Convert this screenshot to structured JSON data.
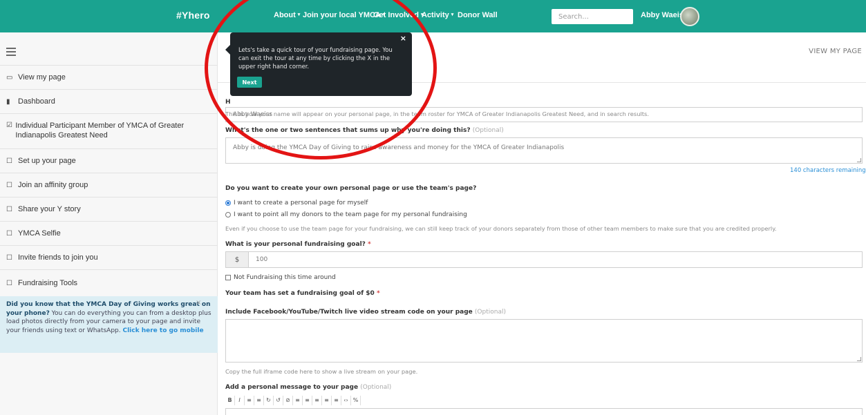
{
  "nav": {
    "brand": "#Yhero",
    "items": [
      {
        "label": "About",
        "caret": "▾"
      },
      {
        "label": "Join your local YMCA",
        "caret": "▾"
      },
      {
        "label": "Get Involved",
        "caret": "▾"
      },
      {
        "label": "Activity",
        "caret": "▾"
      },
      {
        "label": "Donor Wall",
        "caret": ""
      }
    ],
    "search_placeholder": "Search...",
    "username": "Abby Waeiss"
  },
  "sidebar": {
    "items": [
      {
        "icon": "▭",
        "label": "View my page"
      },
      {
        "icon": "▮",
        "label": "Dashboard"
      },
      {
        "icon": "☑",
        "label": "Individual Participant Member of YMCA of Greater Indianapolis Greatest Need"
      },
      {
        "icon": "☐",
        "label": "Set up your page"
      },
      {
        "icon": "☐",
        "label": "Join an affinity group"
      },
      {
        "icon": "☐",
        "label": "Share your Y story"
      },
      {
        "icon": "☐",
        "label": "YMCA Selfie"
      },
      {
        "icon": "☐",
        "label": "Invite friends to join you"
      },
      {
        "icon": "☐",
        "label": "Fundraising Tools"
      }
    ],
    "promo": {
      "bold": "Did you know that the YMCA Day of Giving works great on your phone?",
      "text": " You can do everything you can from a desktop plus load photos directly from your camera to your page and invite your friends using text or WhatsApp. ",
      "link": "Click here to go mobile",
      "close": "×"
    }
  },
  "main": {
    "view_my_page": "VIEW MY PAGE",
    "name_label_fragment": "H",
    "name_value": "Abby Waeiss",
    "name_help": "This is how your name will appear on your personal page, in the team roster for YMCA of Greater Indianapolis Greatest Need, and in search results.",
    "why_label": "What's the one or two sentences that sums up why you're doing this?",
    "optional": "(Optional)",
    "why_value": "Abby is doing the YMCA Day of Giving to raise awareness and money for the YMCA of Greater Indianapolis",
    "chars_remaining": "140 characters remaining",
    "page_choice_label": "Do you want to create your own personal page or use the team's page?",
    "radio_own": "I want to create a personal page for myself",
    "radio_team": "I want to point all my donors to the team page for my personal fundraising",
    "page_choice_help": "Even if you choose to use the team page for your fundraising, we can still keep track of your donors separately from those of other team members to make sure that you are credited properly.",
    "goal_label": "What is your personal fundraising goal?",
    "required": "*",
    "currency": "$",
    "goal_value": "100",
    "not_fundraising": "Not Fundraising this time around",
    "team_goal": "Your team has set a fundraising goal of $0",
    "stream_label": "Include Facebook/YouTube/Twitch live video stream code on your page",
    "stream_help": "Copy the full iframe code here to show a live stream on your page.",
    "message_label": "Add a personal message to your page"
  },
  "tour": {
    "text": "Lets's take a quick tour of your fundraising page. You can exit the tour at any time by clicking the X in the upper right hand corner.",
    "next": "Next",
    "close": "×"
  },
  "annotation_color": "#e31414",
  "brand_color": "#1aa390"
}
